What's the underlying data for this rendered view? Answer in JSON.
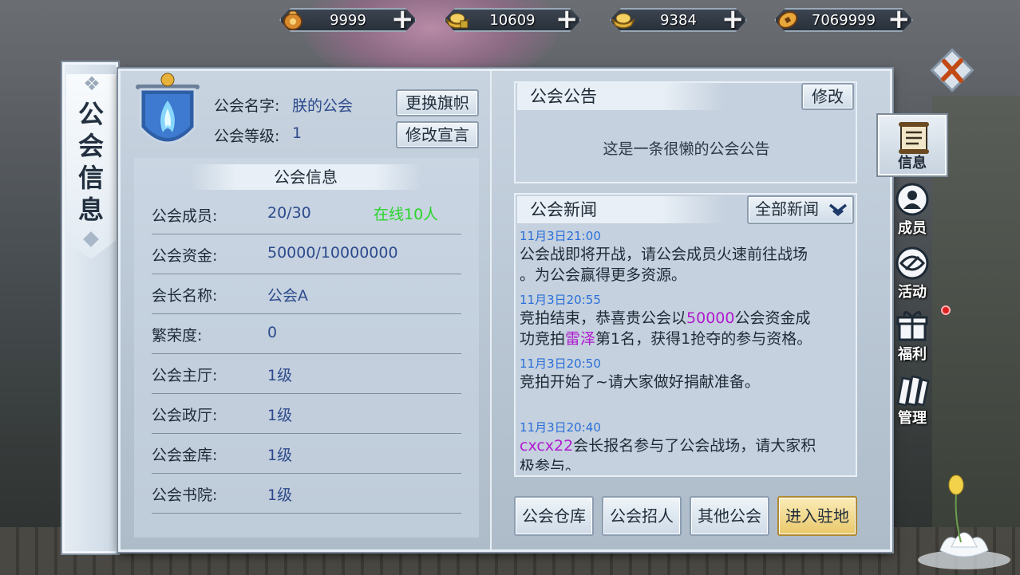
{
  "currencies": [
    {
      "icon": "bag-icon",
      "value": "9999"
    },
    {
      "icon": "locked-ingot-icon",
      "value": "10609"
    },
    {
      "icon": "gold-ingot-icon",
      "value": "9384"
    },
    {
      "icon": "coin-icon",
      "value": "7069999"
    }
  ],
  "side_title": "公会信息",
  "guild": {
    "name_label": "公会名字:",
    "name_value": "朕的公会",
    "level_label": "公会等级:",
    "level_value": "1",
    "change_flag_button": "更换旗帜",
    "edit_declaration_button": "修改宣言"
  },
  "info_section": {
    "title": "公会信息",
    "rows": [
      {
        "label": "公会成员:",
        "value": "20/30",
        "extra": "在线10人"
      },
      {
        "label": "公会资金:",
        "value": "50000/10000000"
      },
      {
        "label": "会长名称:",
        "value": "公会A"
      },
      {
        "label": "繁荣度:",
        "value": "0"
      },
      {
        "label": "公会主厅:",
        "value": "1级"
      },
      {
        "label": "公会政厅:",
        "value": "1级"
      },
      {
        "label": "公会金库:",
        "value": "1级"
      },
      {
        "label": "公会书院:",
        "value": "1级"
      }
    ]
  },
  "notice": {
    "title": "公会公告",
    "edit_button": "修改",
    "text": "这是一条很懒的公会公告"
  },
  "news": {
    "title": "公会新闻",
    "filter": "全部新闻",
    "items": [
      {
        "time": "11月3日21:00",
        "line1": "公会战即将开战，请公会成员火速前往战场",
        "line2": "。为公会赢得更多资源。"
      },
      {
        "time": "11月3日20:55",
        "l1a": "竞拍结束，恭喜贵公会以",
        "l1b": "50000",
        "l1c": "公会资金成",
        "l2a": "功竞拍",
        "l2b": "雷泽",
        "l2c": "第1名，获得1抢夺的参与资格。"
      },
      {
        "time": "11月3日20:50",
        "line1": "竞拍开始了~请大家做好捐献准备。"
      },
      {
        "time": "11月3日20:40",
        "l1a": "cxcx22",
        "l1b": "会长报名参与了公会战场，请大家积",
        "line2": "极参与。"
      }
    ]
  },
  "bottom_buttons": [
    "公会仓库",
    "公会招人",
    "其他公会",
    "进入驻地"
  ],
  "right_tabs": [
    "信息",
    "成员",
    "活动",
    "福利",
    "管理"
  ],
  "colors": {
    "accent_blue": "#2d4a8c",
    "online_green": "#2ad42a",
    "highlight_purple": "#b01bd0",
    "time_blue": "#2a6fd8",
    "enter_button_gold": "#f3d98a"
  }
}
